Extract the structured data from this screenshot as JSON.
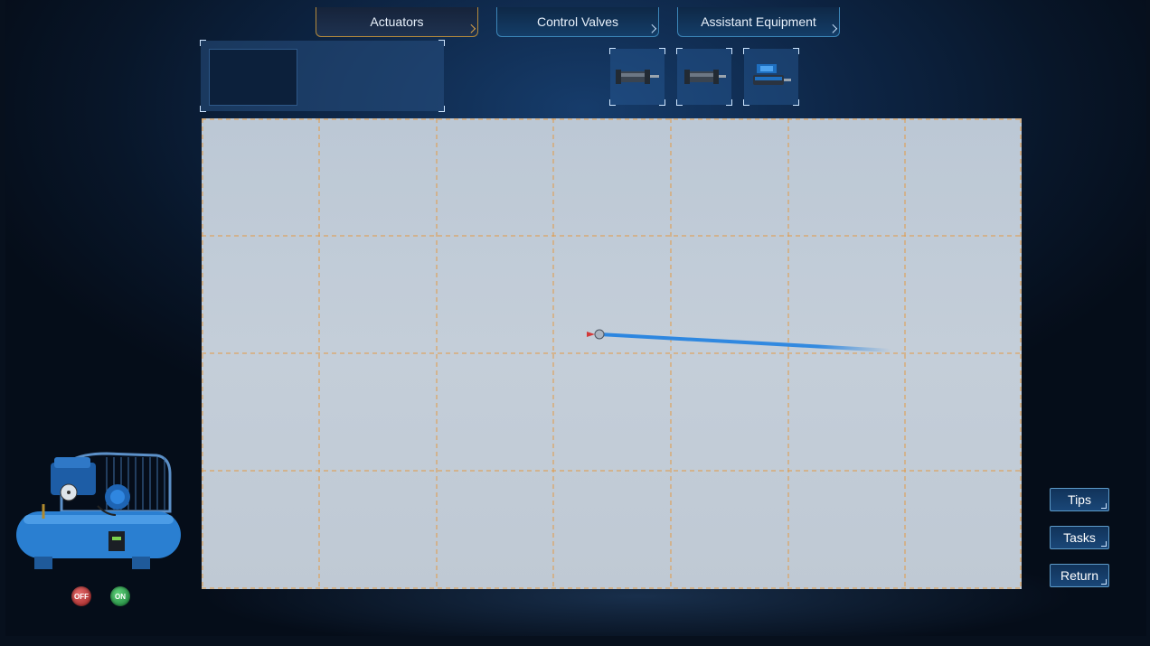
{
  "tabs": [
    {
      "label": "Actuators",
      "active": true
    },
    {
      "label": "Control Valves",
      "active": false
    },
    {
      "label": "Assistant Equipment",
      "active": false
    }
  ],
  "component_tiles": [
    {
      "icon": "cylinder-icon"
    },
    {
      "icon": "cylinder-icon"
    },
    {
      "icon": "valve-cylinder-icon"
    }
  ],
  "side_buttons": {
    "tips": "Tips",
    "tasks": "Tasks",
    "return": "Return"
  },
  "power": {
    "off_label": "OFF",
    "on_label": "ON"
  },
  "canvas": {
    "grid_columns": 7,
    "grid_rows": 4
  },
  "colors": {
    "grid_line": "#e39a45",
    "connector_line": "#2b86e0",
    "tab_active_border": "#b48a3c",
    "button_border": "#5d9ac8"
  }
}
